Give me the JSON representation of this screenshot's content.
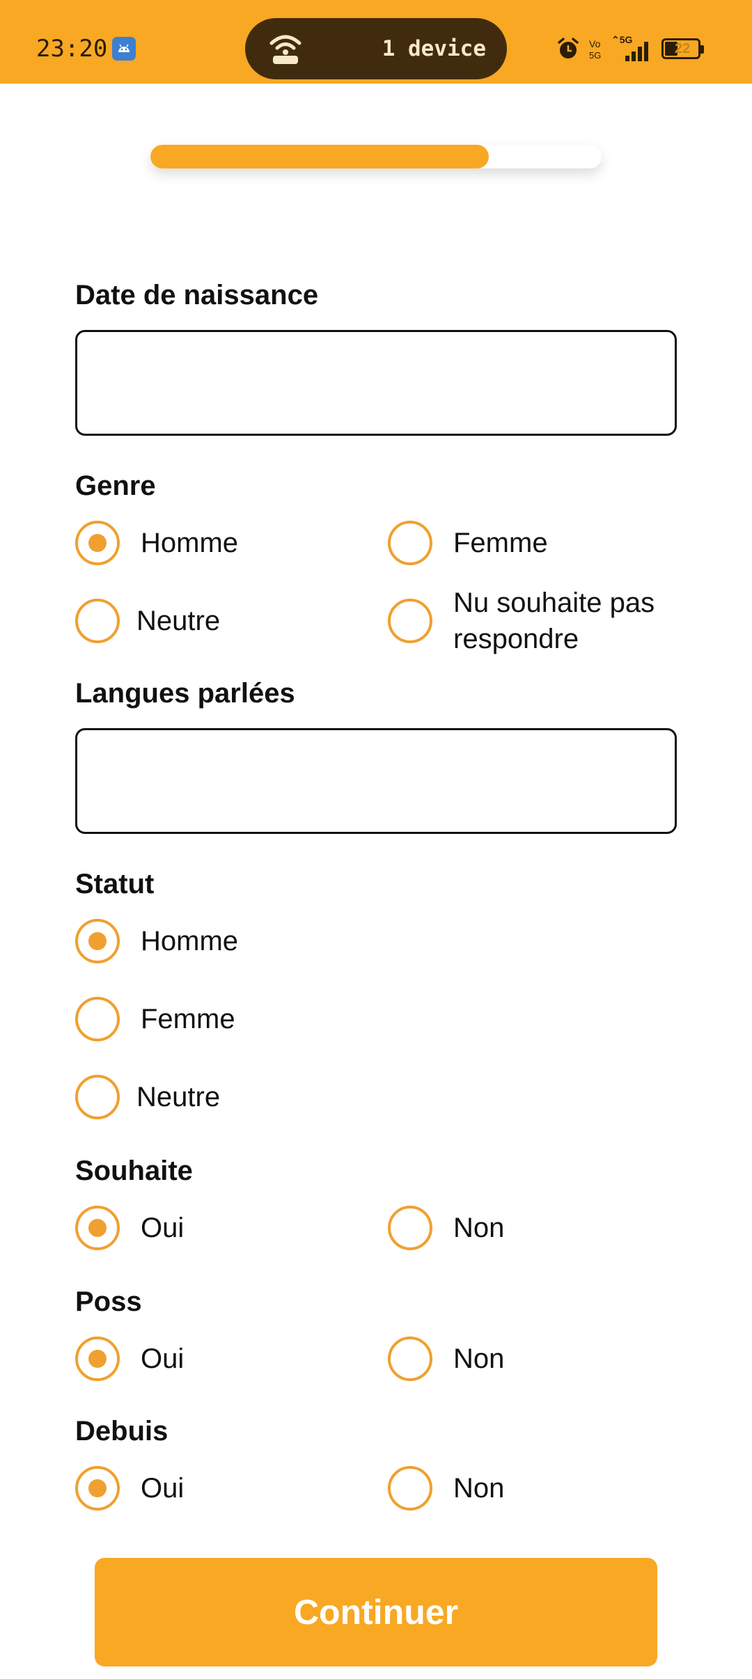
{
  "status_bar": {
    "time": "23:20",
    "hotspot_text": "1 device",
    "network": "5G",
    "volte": "Vo 5G",
    "battery_level": "22",
    "app_icon": "android-icon",
    "icons": [
      "alarm-icon",
      "volte-icon",
      "signal-icon",
      "battery-icon"
    ]
  },
  "progress": {
    "value": 0.75
  },
  "form": {
    "birth_date": {
      "label": "Date de naissance",
      "value": "",
      "placeholder": ""
    },
    "genre": {
      "label": "Genre",
      "options": [
        "Homme",
        "Femme",
        "Neutre",
        "Nu souhaite pas respondre"
      ],
      "selected": "Homme"
    },
    "languages": {
      "label": "Langues parlées",
      "value": "",
      "placeholder": ""
    },
    "statut": {
      "label": "Statut",
      "options": [
        "Homme",
        "Femme",
        "Neutre"
      ],
      "selected": "Homme"
    },
    "souhaite": {
      "label": "Souhaite",
      "options": [
        "Oui",
        "Non"
      ],
      "selected": "Oui"
    },
    "poss": {
      "label": "Poss",
      "options": [
        "Oui",
        "Non"
      ],
      "selected": "Oui"
    },
    "debuis": {
      "label": "Debuis",
      "options": [
        "Oui",
        "Non"
      ],
      "selected": "Oui"
    }
  },
  "continue_label": "Continuer",
  "colors": {
    "accent": "#F8A823",
    "radio": "#F0A030",
    "pill": "#412B0F"
  }
}
